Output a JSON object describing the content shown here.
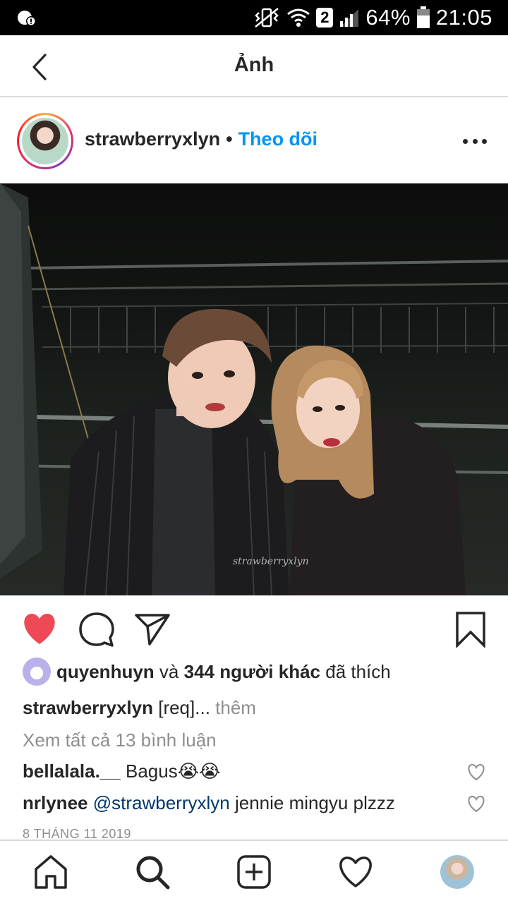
{
  "status_bar": {
    "battery": "64%",
    "time": "21:05",
    "sim": "2"
  },
  "header": {
    "title": "Ảnh"
  },
  "post": {
    "username": "strawberryxlyn",
    "separator": "•",
    "follow_label": "Theo dõi",
    "watermark": "strawberryxlyn",
    "likes": {
      "user": "quyenhuyn",
      "connector": "và",
      "others": "344 người khác",
      "suffix": "đã thích"
    },
    "caption": {
      "user": "strawberryxlyn",
      "text": "[req]...",
      "more": "thêm"
    },
    "view_comments": "Xem tất cả 13 bình luận",
    "comments": [
      {
        "user": "bellalala.__",
        "text": "Bagus😭😭"
      },
      {
        "user": "nrlynee",
        "mention": "@strawberryxlyn",
        "text": "jennie mingyu plzzz"
      }
    ],
    "date": "8 THÁNG 11 2019"
  },
  "icons": {
    "back": "back-arrow-icon",
    "more": "more-options-icon",
    "like": "heart-icon",
    "comment": "comment-icon",
    "share": "send-icon",
    "save": "bookmark-icon",
    "home": "home-icon",
    "search": "search-icon",
    "add": "add-post-icon",
    "activity": "heart-outline-icon"
  },
  "colors": {
    "like_red": "#ed4956",
    "link_blue": "#0095f6",
    "mention_blue": "#00376b",
    "muted": "#8e8e8e"
  }
}
